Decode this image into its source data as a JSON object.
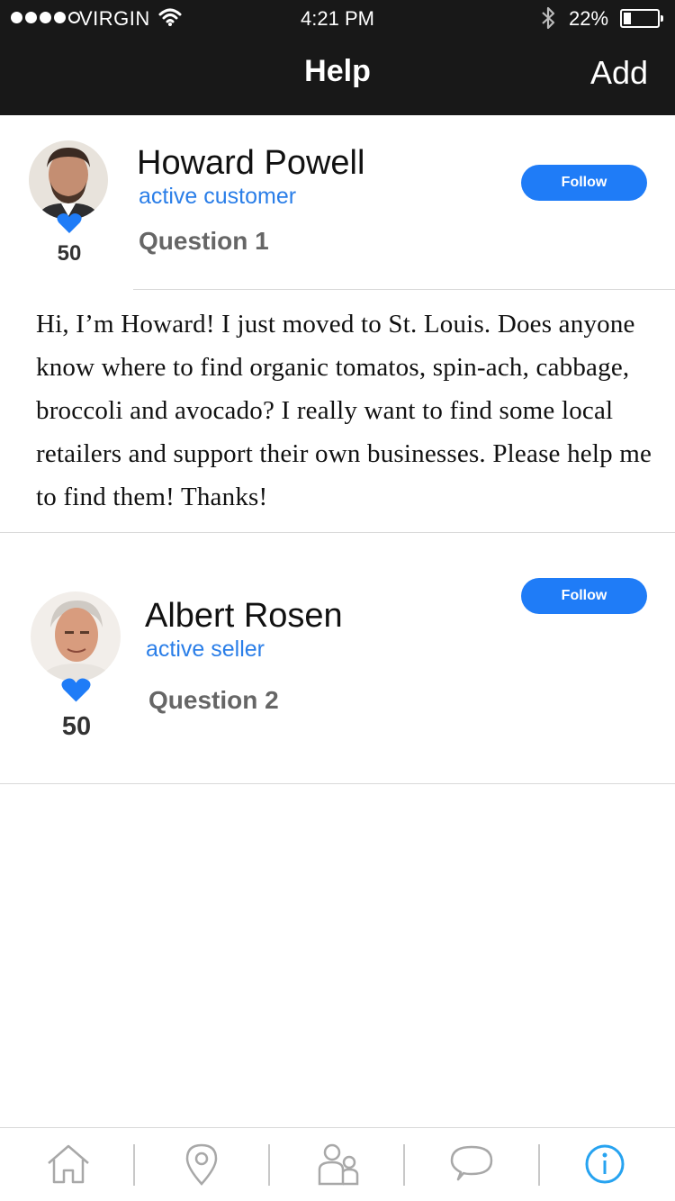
{
  "status_bar": {
    "signal_full": 4,
    "signal_total": 5,
    "carrier": "VIRGIN",
    "time": "4:21 PM",
    "battery_percent": "22%",
    "battery_level": 0.22
  },
  "nav": {
    "title": "Help",
    "add_label": "Add"
  },
  "colors": {
    "accent": "#1f7cf7",
    "role_text": "#2a7ee8",
    "nav_bg": "#181818",
    "tab_active": "#27a3f0",
    "tab_inactive": "#a8a8a8"
  },
  "posts": [
    {
      "name": "Howard Powell",
      "role": "active customer",
      "question": "Question 1",
      "likes": "50",
      "follow_label": "Follow",
      "body": "Hi, I’m Howard! I just moved to St. Louis. Does anyone know where to find organic tomatos, spin-ach, cabbage, broccoli and avocado? I really want to find some local retailers and support their own businesses. Please help me to find them! Thanks!",
      "heart_icon": "heart-icon"
    },
    {
      "name": "Albert Rosen",
      "role": "active seller",
      "question": "Question 2",
      "likes": "50",
      "follow_label": "Follow",
      "heart_icon": "heart-icon"
    }
  ],
  "tabs": [
    {
      "icon": "home-icon",
      "active": false
    },
    {
      "icon": "location-pin-icon",
      "active": false
    },
    {
      "icon": "people-icon",
      "active": false
    },
    {
      "icon": "chat-bubble-icon",
      "active": false
    },
    {
      "icon": "info-icon",
      "active": true
    }
  ]
}
